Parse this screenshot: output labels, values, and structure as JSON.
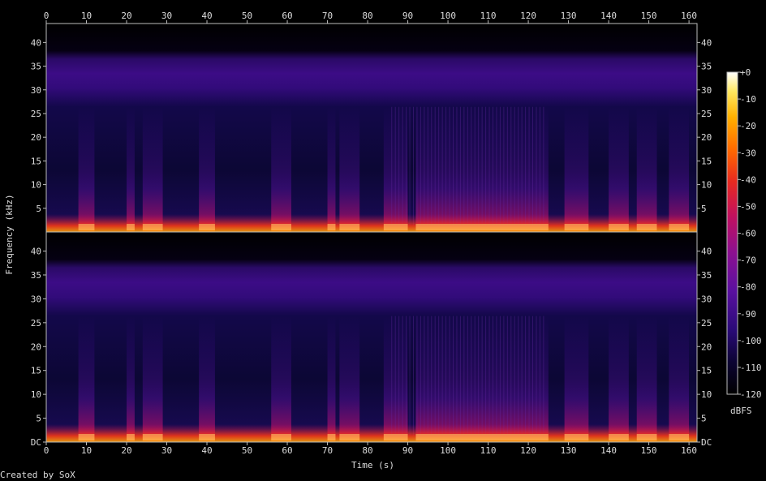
{
  "chart_data": {
    "type": "heatmap",
    "title": "",
    "xlabel": "Time (s)",
    "ylabel": "Frequency (kHz)",
    "x_ticks": [
      "0",
      "10",
      "20",
      "30",
      "40",
      "50",
      "60",
      "70",
      "80",
      "90",
      "100",
      "110",
      "120",
      "130",
      "140",
      "150",
      "160"
    ],
    "xlim": [
      0,
      162
    ],
    "channels": [
      {
        "y_ticks_left": [
          "5",
          "10",
          "15",
          "20",
          "25",
          "30",
          "35",
          "40"
        ],
        "y_ticks_right": [
          "5",
          "10",
          "15",
          "20",
          "25",
          "30",
          "35",
          "40"
        ],
        "bottom_label": ""
      },
      {
        "y_ticks_left": [
          "DC",
          "5",
          "10",
          "15",
          "20",
          "25",
          "30",
          "35",
          "40"
        ],
        "y_ticks_right": [
          "DC",
          "5",
          "10",
          "15",
          "20",
          "25",
          "30",
          "35",
          "40"
        ],
        "bottom_label": "DC"
      }
    ],
    "ylim": [
      0,
      44
    ],
    "colorbar": {
      "label": "dBFS",
      "ticks": [
        "+0",
        "-10",
        "-20",
        "-30",
        "-40",
        "-50",
        "-60",
        "-70",
        "-80",
        "-90",
        "-100",
        "-110",
        "-120"
      ],
      "range": [
        -120,
        0
      ],
      "colors": [
        "#000000",
        "#0c0433",
        "#2a0a78",
        "#5a10a0",
        "#8c1090",
        "#c01060",
        "#e82a20",
        "#ff6a00",
        "#ffb000",
        "#ffe860",
        "#ffffff"
      ]
    },
    "activity_segments_s": [
      [
        8,
        12
      ],
      [
        20,
        22
      ],
      [
        24,
        29
      ],
      [
        38,
        42
      ],
      [
        56,
        61
      ],
      [
        70,
        72
      ],
      [
        73,
        78
      ],
      [
        84,
        90
      ],
      [
        92,
        125
      ],
      [
        129,
        135
      ],
      [
        140,
        145
      ],
      [
        147,
        152
      ],
      [
        155,
        160
      ]
    ]
  },
  "footer": {
    "credit": "Created by SoX"
  }
}
